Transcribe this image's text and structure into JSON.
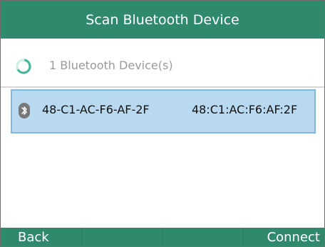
{
  "title": "Scan Bluetooth Device",
  "status": {
    "text": "1 Bluetooth Device(s)",
    "icon": "loading-spinner-icon"
  },
  "devices": [
    {
      "name": "48-C1-AC-F6-AF-2F",
      "mac": "48:C1:AC:F6:AF:2F",
      "icon": "bluetooth-icon",
      "selected": true
    }
  ],
  "softkeys": [
    "Back",
    "",
    "",
    "Connect"
  ],
  "colors": {
    "header": "#2f8a6d",
    "selection_fill": "#b9d9f1",
    "selection_border": "#7fb7e5"
  }
}
